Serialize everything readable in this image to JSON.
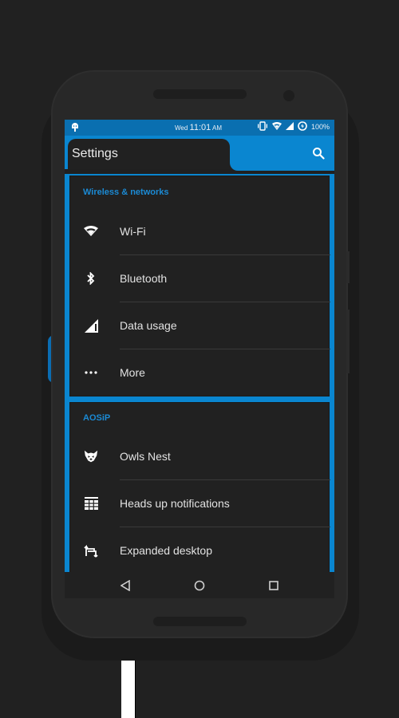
{
  "colors": {
    "accent": "#0a86d0",
    "statusbar": "#0a6fb0",
    "card_bg": "#212121",
    "section_title": "#1b8ad4",
    "text_primary": "#e2e2e2"
  },
  "statusbar": {
    "notification_icon": "android-icon",
    "day": "Wed",
    "time": "11:01",
    "ampm": "AM",
    "icons": [
      "vibrate-icon",
      "wifi-icon",
      "cell-signal-icon",
      "battery-saver-icon"
    ],
    "battery": "100%"
  },
  "appbar": {
    "title": "Settings",
    "search_icon": "search-icon"
  },
  "sections": [
    {
      "title": "Wireless & networks",
      "items": [
        {
          "label": "Wi-Fi",
          "icon": "wifi-icon"
        },
        {
          "label": "Bluetooth",
          "icon": "bluetooth-icon"
        },
        {
          "label": "Data usage",
          "icon": "data-usage-icon"
        },
        {
          "label": "More",
          "icon": "more-dots-icon"
        }
      ]
    },
    {
      "title": "AOSiP",
      "items": [
        {
          "label": "Owls Nest",
          "icon": "owl-icon"
        },
        {
          "label": "Heads up notifications",
          "icon": "grid-icon"
        },
        {
          "label": "Expanded desktop",
          "icon": "expand-arrows-icon"
        }
      ]
    }
  ],
  "navbar": {
    "back": "back-icon",
    "home": "home-icon",
    "recents": "recents-icon"
  }
}
